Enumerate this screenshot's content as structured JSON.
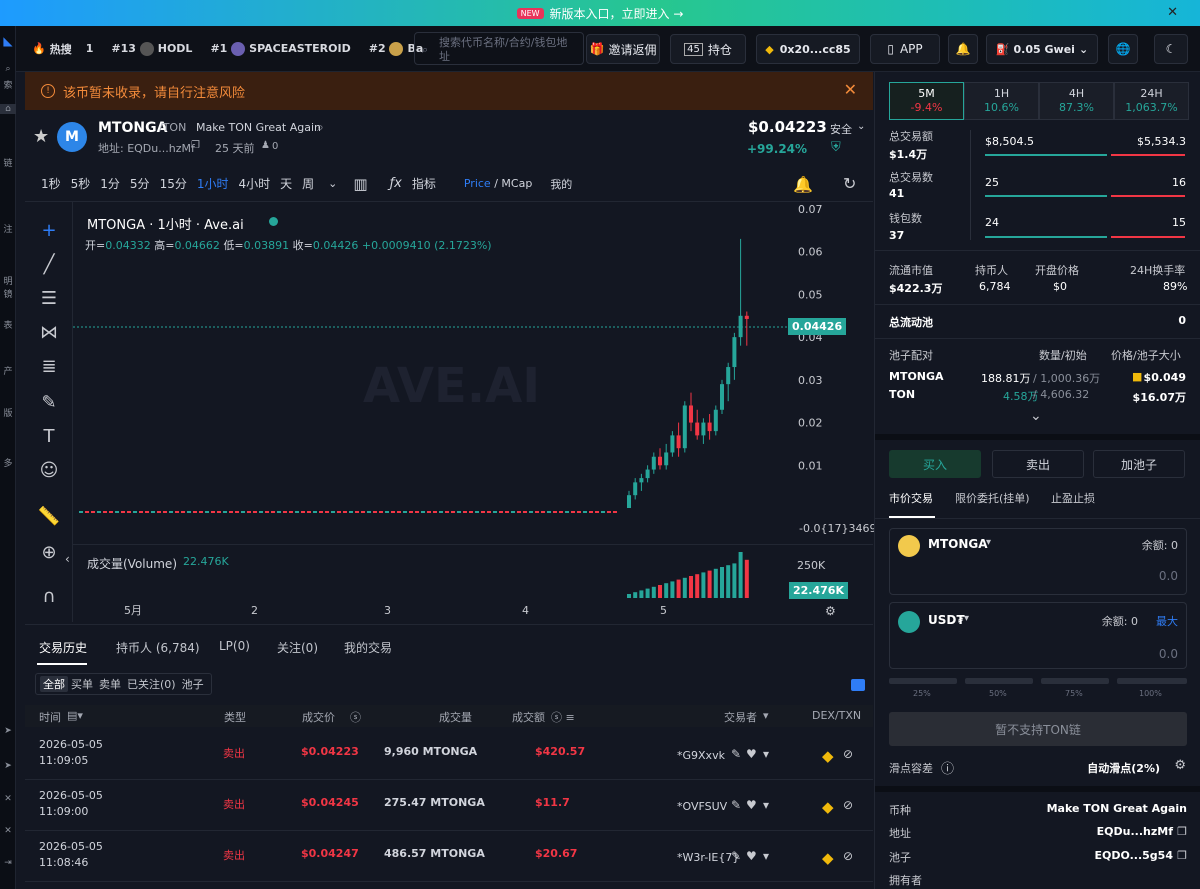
{
  "banner": {
    "badge": "NEW",
    "text": "新版本入口，立即进入 →",
    "close": "✕"
  },
  "leftbar": {
    "labels": [
      "索",
      "链",
      "注",
      "明镜",
      "表",
      "产",
      "版",
      "多"
    ]
  },
  "topnav": {
    "hot_label": "热搜",
    "hot_items": [
      {
        "rank": "1"
      },
      {
        "rank": "#13",
        "name": "HODL"
      },
      {
        "rank": "#1",
        "name": "SPACEASTEROID"
      },
      {
        "rank": "#2",
        "name": "Ba"
      }
    ],
    "search_placeholder": "搜索代币名称/合约/钱包地址",
    "invite": "邀请返佣",
    "holdings_count": "45",
    "holdings": "持仓",
    "wallet": "0x20...cc85",
    "app": "APP",
    "gas": "0.05 Gwei"
  },
  "warning": {
    "text": "该币暂未收录，请自行注意风险"
  },
  "token": {
    "avatar": "M",
    "symbol": "MTONGA",
    "chain": "/TON",
    "name": "Make TON Great Again",
    "address_label": "地址: EQDu...hzMf",
    "age": "25 天前",
    "count": "0",
    "price": "$0.04223",
    "change": "+99.24%",
    "safety": "安全"
  },
  "timeframes": [
    "1秒",
    "5秒",
    "1分",
    "5分",
    "15分",
    "1小时",
    "4小时",
    "天",
    "周"
  ],
  "active_tf": "1小时",
  "toolbar": {
    "indicators": "指标",
    "price": "Price",
    "mcap": "MCap",
    "mine": "我的"
  },
  "chart_info": {
    "title": "MTONGA · 1小时 · Ave.ai",
    "open_label": "开=",
    "open": "0.04332",
    "high_label": "高=",
    "high": "0.04662",
    "low_label": "低=",
    "low": "0.03891",
    "close_label": "收=",
    "close": "0.04426",
    "change": "+0.0009410 (2.1723%)",
    "watermark": "AVE.AI",
    "volume_label": "成交量(Volume)",
    "volume_value": "22.476K",
    "current_price_tag": "0.04426",
    "current_volume_tag": "22.476K",
    "bottom_price_label": "-0.0{17}3469",
    "vol_axis_label": "250K"
  },
  "chart_data": {
    "type": "candlestick",
    "x_ticks": [
      "5月",
      "2",
      "3",
      "4",
      "5"
    ],
    "y_ticks": [
      "0.07",
      "0.06",
      "0.05",
      "0.04",
      "0.03",
      "0.02",
      "0.01"
    ],
    "ylim": [
      -0.005,
      0.07
    ],
    "ohlc_recent": [
      [
        0.0,
        0.004,
        0.0,
        0.003
      ],
      [
        0.003,
        0.007,
        0.002,
        0.006
      ],
      [
        0.006,
        0.008,
        0.004,
        0.007
      ],
      [
        0.007,
        0.01,
        0.006,
        0.009
      ],
      [
        0.009,
        0.013,
        0.008,
        0.012
      ],
      [
        0.012,
        0.014,
        0.009,
        0.01
      ],
      [
        0.01,
        0.015,
        0.009,
        0.013
      ],
      [
        0.013,
        0.018,
        0.012,
        0.017
      ],
      [
        0.017,
        0.02,
        0.012,
        0.014
      ],
      [
        0.014,
        0.025,
        0.013,
        0.024
      ],
      [
        0.024,
        0.027,
        0.018,
        0.02
      ],
      [
        0.02,
        0.023,
        0.016,
        0.017
      ],
      [
        0.017,
        0.021,
        0.015,
        0.02
      ],
      [
        0.02,
        0.022,
        0.016,
        0.018
      ],
      [
        0.018,
        0.024,
        0.017,
        0.023
      ],
      [
        0.023,
        0.03,
        0.022,
        0.029
      ],
      [
        0.029,
        0.034,
        0.025,
        0.033
      ],
      [
        0.033,
        0.041,
        0.03,
        0.04
      ],
      [
        0.04,
        0.063,
        0.038,
        0.045
      ],
      [
        0.045,
        0.046,
        0.038,
        0.04426
      ]
    ]
  },
  "bottom": {
    "tabs": [
      "交易历史",
      "持币人 (6,784)",
      "LP(0)",
      "关注(0)",
      "我的交易"
    ],
    "subtabs": [
      "全部",
      "买单",
      "卖单",
      "已关注(0)",
      "池子"
    ],
    "headers": [
      "时间",
      "类型",
      "成交价",
      "成交量",
      "成交额",
      "交易者",
      "DEX/TXN"
    ],
    "rows": [
      {
        "date": "2026-05-05",
        "time": "11:09:05",
        "type": "卖出",
        "price": "$0.04223",
        "qty": "9,960 MTONGA",
        "amount": "$420.57",
        "trader": "*G9Xxvk"
      },
      {
        "date": "2026-05-05",
        "time": "11:09:00",
        "type": "卖出",
        "price": "$0.04245",
        "qty": "275.47 MTONGA",
        "amount": "$11.7",
        "trader": "*OVFSUV"
      },
      {
        "date": "2026-05-05",
        "time": "11:08:46",
        "type": "卖出",
        "price": "$0.04247",
        "qty": "486.57 MTONGA",
        "amount": "$20.67",
        "trader": "*W3r-IE{7}"
      }
    ]
  },
  "right": {
    "periods": [
      {
        "label": "5M",
        "change": "-9.4%"
      },
      {
        "label": "1H",
        "change": "10.6%"
      },
      {
        "label": "4H",
        "change": "87.3%"
      },
      {
        "label": "24H",
        "change": "1,063.7%"
      }
    ],
    "stats": [
      {
        "label": "总交易额",
        "value": "$1.4万",
        "buy": "$8,504.5",
        "sell": "$5,534.3"
      },
      {
        "label": "总交易数",
        "value": "41",
        "buy": "25",
        "sell": "16"
      },
      {
        "label": "钱包数",
        "value": "37",
        "buy": "24",
        "sell": "15"
      }
    ],
    "metrics": [
      {
        "label": "流通市值",
        "value": "$422.3万"
      },
      {
        "label": "持币人",
        "value": "6,784"
      },
      {
        "label": "开盘价格",
        "value": "$0"
      },
      {
        "label": "24H换手率",
        "value": "89%"
      }
    ],
    "pool_total_label": "总流动池",
    "pool_total_value": "0",
    "pool_header": [
      "池子配对",
      "数量/初始",
      "价格/池子大小"
    ],
    "pool_token1": "MTONGA",
    "pool_token2": "TON",
    "pool_qty1": "188.81万",
    "pool_init1": "/ 1,000.36万",
    "pool_qty2": "4.58万",
    "pool_init2": "/ 4,606.32",
    "pool_price": "$0.049",
    "pool_size": "$16.07万",
    "buy": "买入",
    "sell": "卖出",
    "add_pool": "加池子",
    "order_tabs": [
      "市价交易",
      "限价委托(挂单)",
      "止盈止损"
    ],
    "from_token": "MTONGA",
    "from_balance": "余额: 0",
    "from_amount": "0.0",
    "to_token": "USD₮",
    "to_balance": "余额: 0",
    "max": "最大",
    "to_amount": "0.0",
    "percents": [
      "25%",
      "50%",
      "75%",
      "100%"
    ],
    "unsupported": "暂不支持TON链",
    "slippage_label": "滑点容差",
    "slippage_value": "自动滑点(2%)",
    "info": [
      {
        "label": "币种",
        "value": "Make TON Great Again"
      },
      {
        "label": "地址",
        "value": "EQDu...hzMf"
      },
      {
        "label": "池子",
        "value": "EQDO...5g54"
      },
      {
        "label": "拥有者",
        "value": ""
      }
    ]
  },
  "colors": {
    "up": "#26a69a",
    "down": "#f23645",
    "accent": "#2f7df6",
    "warn": "#f28a3a"
  }
}
